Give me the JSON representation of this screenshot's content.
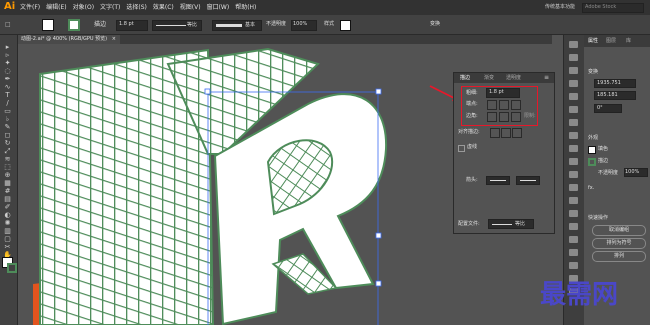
{
  "app": {
    "logo": "Ai",
    "workspace_label": "传统基本功能",
    "search_placeholder": "Adobe Stock"
  },
  "menu": [
    "文件(F)",
    "编辑(E)",
    "对象(O)",
    "文字(T)",
    "选择(S)",
    "效果(C)",
    "视图(V)",
    "窗口(W)",
    "帮助(H)"
  ],
  "control_bar": {
    "stroke_label": "描边",
    "stroke_value": "1.8 pt",
    "profile_label": "等比",
    "brush_label": "基本",
    "opacity_label": "不透明度",
    "opacity_value": "100%",
    "style_label": "样式",
    "transform_label": "变换"
  },
  "document_tab": {
    "title": "动图-2.ai* @ 400% (RGB/GPU 预览)",
    "close": "×"
  },
  "stroke_panel": {
    "tabs": [
      "描边",
      "渐变",
      "透明度"
    ],
    "weight_label": "粗细:",
    "weight_value": "1.8 pt",
    "cap_label": "端点:",
    "corner_label": "边角:",
    "limit_label": "限制:",
    "align_label": "对齐描边:",
    "dashed_label": "虚线",
    "arrow_label": "箭头:",
    "profile_label": "配置文件:",
    "profile_value": "等比"
  },
  "right_panel": {
    "tabs": [
      "属性",
      "图层",
      "库"
    ],
    "transform_label": "变换",
    "x_value": "1935.751",
    "y_value": "185.181",
    "angle_value": "0°",
    "appearance_label": "外观",
    "fill_label": "填色",
    "stroke_label": "描边",
    "opacity_label": "不透明度",
    "opacity_value": "100%",
    "fx_label": "fx.",
    "quick_actions_label": "快速操作",
    "action1": "取消编组",
    "action2": "排列为符号",
    "action3": "排列"
  },
  "watermark": "最需网",
  "colors": {
    "accent": "#e6182a",
    "art_green": "#4e8c5a",
    "art_orange": "#e2541e",
    "selection": "#3d6df2",
    "watermark": "#4a47c8"
  }
}
